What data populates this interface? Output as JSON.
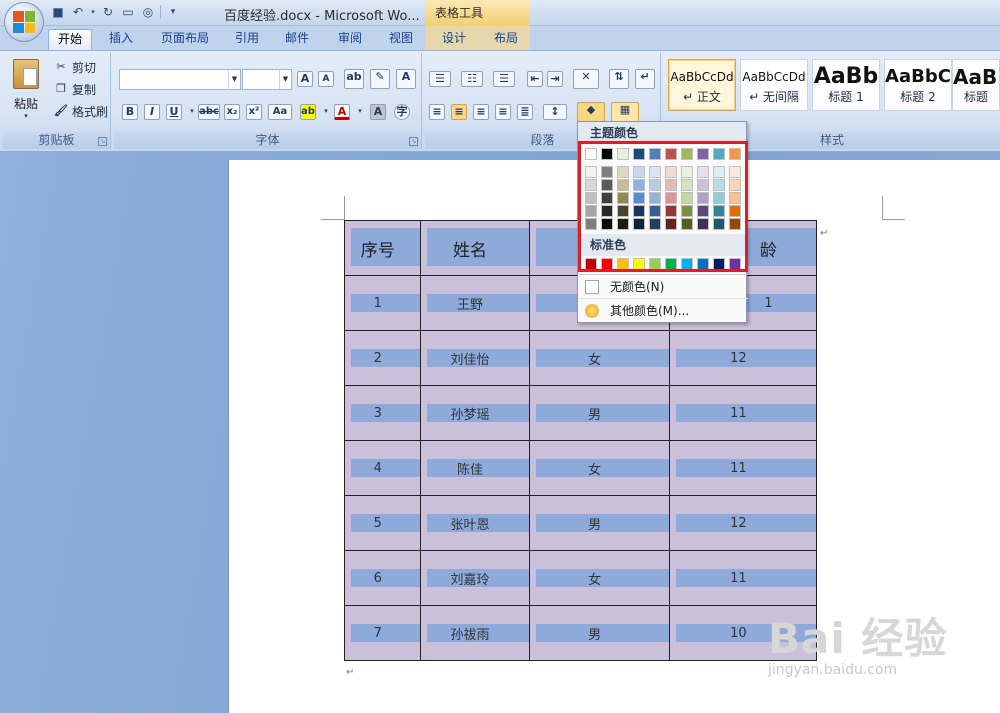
{
  "titlebar": {
    "doc_title": "百度经验.docx - Microsoft Wo...",
    "tools_title": "表格工具",
    "qat": [
      "save-icon",
      "undo-icon",
      "redo-icon",
      "new-doc-icon",
      "print-preview-icon",
      "customize-icon"
    ]
  },
  "tabs": [
    "开始",
    "插入",
    "页面布局",
    "引用",
    "邮件",
    "审阅",
    "视图",
    "设计",
    "布局"
  ],
  "clipboard": {
    "paste": "粘贴",
    "cut": "剪切",
    "copy": "复制",
    "format_painter": "格式刷",
    "label": "剪贴板"
  },
  "font": {
    "label": "字体",
    "font_name": "",
    "font_size": ""
  },
  "paragraph": {
    "label": "段落"
  },
  "styles": {
    "label": "样式",
    "tiles": [
      {
        "sample": "AaBbCcDd",
        "name": "↵ 正文"
      },
      {
        "sample": "AaBbCcDd",
        "name": "↵ 无间隔"
      },
      {
        "sample": "AaBb",
        "name": "标题 1"
      },
      {
        "sample": "AaBbC",
        "name": "标题 2"
      },
      {
        "sample": "AaBb",
        "name": "标题"
      }
    ]
  },
  "shading_menu": {
    "theme_header": "主题颜色",
    "standard_header": "标准色",
    "no_color": "无颜色(N)",
    "more_colors": "其他颜色(M)...",
    "theme_top": [
      "#ffffff",
      "#000000",
      "#eeece1",
      "#1f497d",
      "#4f81bd",
      "#c0504d",
      "#9bbb59",
      "#8064a2",
      "#4bacc6",
      "#f79646"
    ],
    "theme_shades": [
      [
        "#f2f2f2",
        "#7f7f7f",
        "#ddd9c3",
        "#c6d9f0",
        "#dbe5f1",
        "#f2dcdb",
        "#ebf1dd",
        "#e5e0ec",
        "#dbeef3",
        "#fdeada"
      ],
      [
        "#d8d8d8",
        "#595959",
        "#c4bd97",
        "#8db3e2",
        "#b8cce4",
        "#e5b9b7",
        "#d7e3bc",
        "#ccc1d9",
        "#b7dde8",
        "#fbd5b5"
      ],
      [
        "#bfbfbf",
        "#3f3f3f",
        "#938953",
        "#548dd4",
        "#95b3d7",
        "#d99694",
        "#c3d69b",
        "#b2a2c7",
        "#92cddc",
        "#fac08f"
      ],
      [
        "#a5a5a5",
        "#262626",
        "#494429",
        "#17365d",
        "#366092",
        "#953734",
        "#76923c",
        "#5f497a",
        "#31859b",
        "#e36c09"
      ],
      [
        "#7f7f7f",
        "#0c0c0c",
        "#1d1b10",
        "#0f243e",
        "#244061",
        "#632423",
        "#4f6128",
        "#3f3151",
        "#205867",
        "#974806"
      ]
    ],
    "standard": [
      "#c00000",
      "#ff0000",
      "#ffc000",
      "#ffff00",
      "#92d050",
      "#00b050",
      "#00b0f0",
      "#0070c0",
      "#002060",
      "#7030a0"
    ]
  },
  "table": {
    "headers": [
      "序号",
      "姓名",
      "",
      "龄"
    ],
    "rows": [
      [
        "1",
        "王野",
        "",
        "1"
      ],
      [
        "2",
        "刘佳怡",
        "女",
        "12"
      ],
      [
        "3",
        "孙梦瑶",
        "男",
        "11"
      ],
      [
        "4",
        "陈佳",
        "女",
        "11"
      ],
      [
        "5",
        "张叶恩",
        "男",
        "12"
      ],
      [
        "6",
        "刘嘉玲",
        "女",
        "11"
      ],
      [
        "7",
        "孙祓雨",
        "男",
        "10"
      ]
    ]
  },
  "watermark": {
    "main": "Bai 经验",
    "sub": "jingyan.baidu.com"
  }
}
